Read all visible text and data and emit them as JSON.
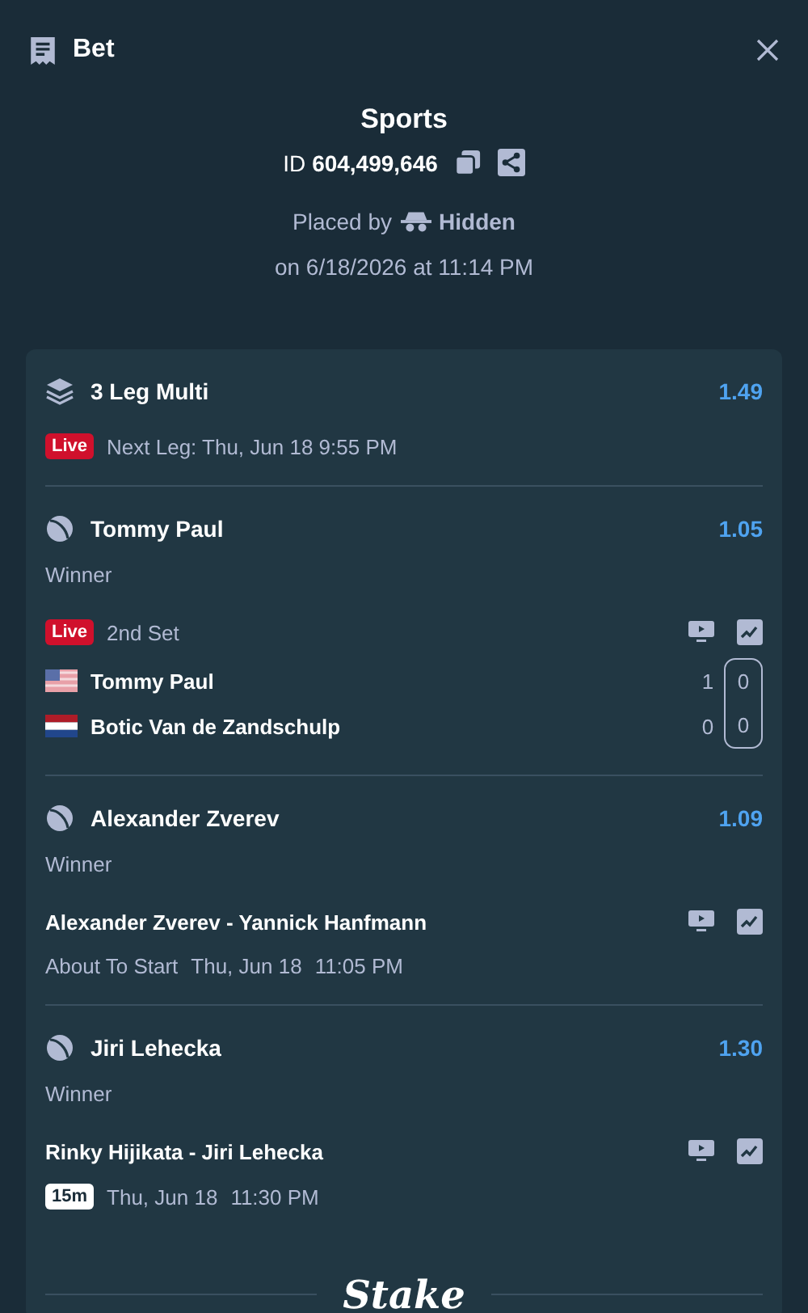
{
  "header": {
    "title": "Bet"
  },
  "summary": {
    "title": "Sports",
    "id_label": "ID",
    "id_value": "604,499,646",
    "placed_by": "Placed by",
    "user": "Hidden",
    "date": "on 6/18/2026 at 11:14 PM"
  },
  "multi": {
    "title": "3 Leg Multi",
    "odds": "1.49",
    "badge": {
      "kind": "live",
      "text": "Live"
    },
    "next_leg": "Next Leg: Thu, Jun 18 9:55 PM"
  },
  "legs": [
    {
      "kind": "live",
      "name": "Tommy Paul",
      "odds": "1.05",
      "market": "Winner",
      "badge": {
        "kind": "live",
        "text": "Live"
      },
      "status": "2nd Set",
      "players": [
        {
          "name": "Tommy Paul",
          "kind": "usa",
          "sets": "1",
          "games": "0"
        },
        {
          "name": "Botic Van de Zandschulp",
          "kind": "netherlands",
          "sets": "0",
          "games": "0"
        }
      ]
    },
    {
      "kind": "upcoming",
      "name": "Alexander Zverev",
      "odds": "1.09",
      "market": "Winner",
      "match": "Alexander Zverev - Yannick Hanfmann",
      "status": "About To Start",
      "date": "Thu, Jun 18",
      "time": "11:05 PM"
    },
    {
      "kind": "upcoming",
      "name": "Jiri Lehecka",
      "odds": "1.30",
      "market": "Winner",
      "match": "Rinky Hijikata - Jiri Lehecka",
      "badge": {
        "kind": "timer",
        "text": "15m"
      },
      "date": "Thu, Jun 18",
      "time": "11:30 PM"
    }
  ],
  "footer": {
    "logo": "Stake"
  }
}
